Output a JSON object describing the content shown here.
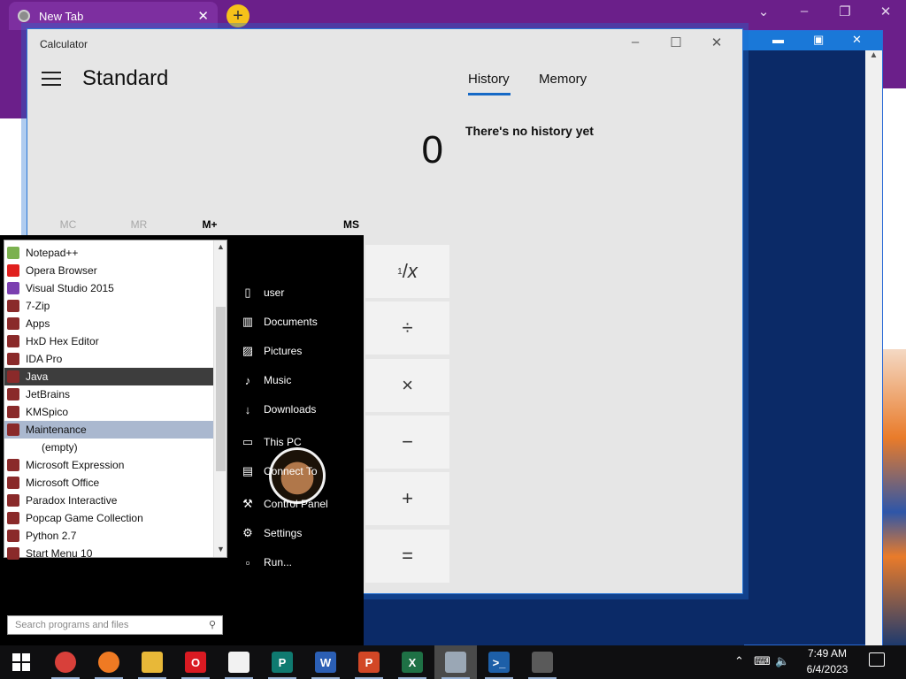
{
  "browser": {
    "tab_title": "New Tab",
    "tab_close": "✕",
    "new_tab": "+",
    "min": "–",
    "restore": "❐",
    "close": "✕"
  },
  "calculator": {
    "title": "Calculator",
    "mode": "Standard",
    "display": "0",
    "memory_buttons": [
      "MC",
      "MR",
      "M+",
      "MS"
    ],
    "tabs": {
      "history": "History",
      "memory": "Memory"
    },
    "history_empty": "There's no history yet",
    "keys": {
      "reciprocal": "x",
      "divide": "÷",
      "multiply": "×",
      "subtract": "−",
      "add": "+",
      "equals": "="
    }
  },
  "start_menu": {
    "programs": [
      {
        "label": "Notepad++",
        "color": "#7bb14f"
      },
      {
        "label": "Opera Browser",
        "color": "#e0201e"
      },
      {
        "label": "Visual Studio 2015",
        "color": "#7b3fb0"
      },
      {
        "label": "7-Zip",
        "color": "#8a2a2a"
      },
      {
        "label": "Apps",
        "color": "#8a2a2a"
      },
      {
        "label": "HxD Hex Editor",
        "color": "#8a2a2a"
      },
      {
        "label": "IDA Pro",
        "color": "#8a2a2a"
      },
      {
        "label": "Java",
        "color": "#8a2a2a"
      },
      {
        "label": "JetBrains",
        "color": "#8a2a2a"
      },
      {
        "label": "KMSpico",
        "color": "#8a2a2a"
      },
      {
        "label": "Maintenance",
        "color": "#8a2a2a"
      },
      {
        "label": "(empty)",
        "color": ""
      },
      {
        "label": "Microsoft Expression",
        "color": "#8a2a2a"
      },
      {
        "label": "Microsoft Office",
        "color": "#8a2a2a"
      },
      {
        "label": "Paradox Interactive",
        "color": "#8a2a2a"
      },
      {
        "label": "Popcap Game Collection",
        "color": "#8a2a2a"
      },
      {
        "label": "Python 2.7",
        "color": "#8a2a2a"
      },
      {
        "label": "Start Menu 10",
        "color": "#8a2a2a"
      }
    ],
    "right_items": [
      {
        "label": "user",
        "icon": "user-folder-icon",
        "glyph": "▯"
      },
      {
        "label": "Documents",
        "icon": "documents-icon",
        "glyph": "▥"
      },
      {
        "label": "Pictures",
        "icon": "pictures-icon",
        "glyph": "▨"
      },
      {
        "label": "Music",
        "icon": "music-icon",
        "glyph": "♪"
      },
      {
        "label": "Downloads",
        "icon": "downloads-icon",
        "glyph": "↓"
      },
      {
        "label": "This PC",
        "icon": "computer-icon",
        "glyph": "▭"
      },
      {
        "label": "Connect To",
        "icon": "connect-icon",
        "glyph": "▤"
      },
      {
        "label": "Control Panel",
        "icon": "wrench-icon",
        "glyph": "⚒"
      },
      {
        "label": "Settings",
        "icon": "gear-icon",
        "glyph": "⚙"
      },
      {
        "label": "Run...",
        "icon": "run-icon",
        "glyph": "▫"
      }
    ],
    "search_placeholder": "Search programs and files"
  },
  "taskbar": {
    "apps": [
      {
        "name": "chrome",
        "color": "#d8403a"
      },
      {
        "name": "firefox",
        "color": "#ef7a23"
      },
      {
        "name": "file-explorer",
        "color": "#e8b838"
      },
      {
        "name": "opera",
        "color": "#d91a22"
      },
      {
        "name": "java",
        "color": "#f2f2f2"
      },
      {
        "name": "publisher",
        "color": "#0f7a70"
      },
      {
        "name": "word",
        "color": "#2b5fb5"
      },
      {
        "name": "powerpoint",
        "color": "#d24726"
      },
      {
        "name": "excel",
        "color": "#1e7145"
      },
      {
        "name": "windows-app",
        "color": "#9aa7b5"
      },
      {
        "name": "powershell",
        "color": "#1d5fa8"
      },
      {
        "name": "calculator",
        "color": "#5a5a5a"
      }
    ],
    "time": "7:49 AM",
    "date": "6/4/2023"
  }
}
